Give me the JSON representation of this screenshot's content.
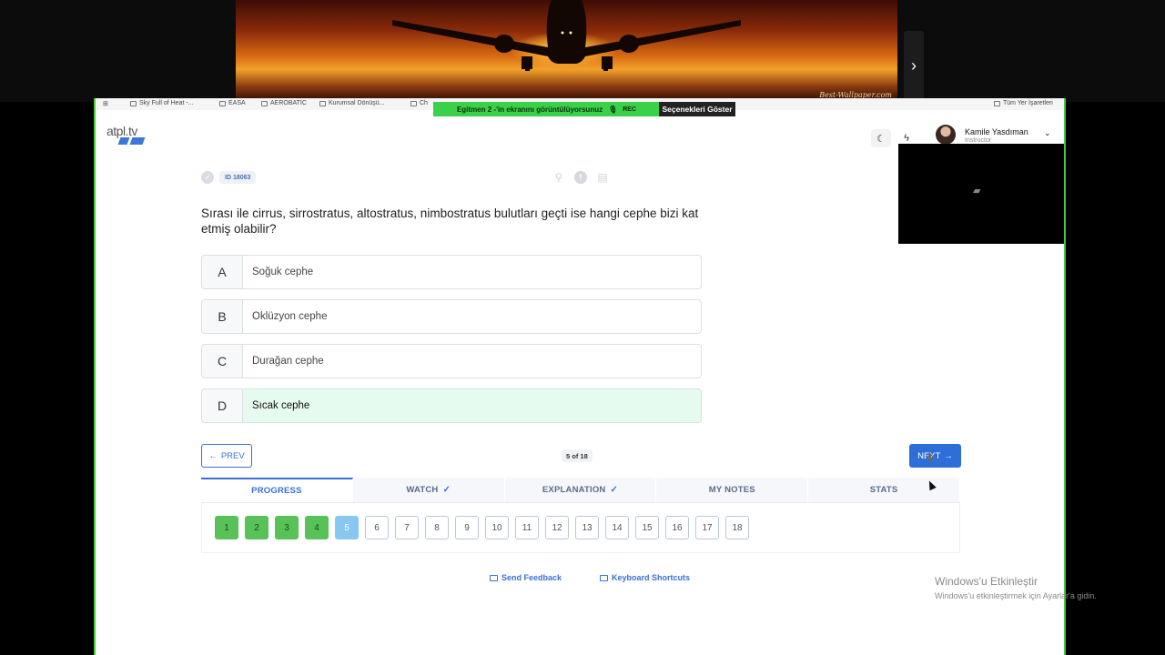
{
  "share": {
    "banner": "Egitmen 2 -'in ekranını görüntülüyorsunuz",
    "rec": "REC",
    "options_button": "Seçenekleri Göster",
    "watermark": "Best-Wallpaper.com"
  },
  "bookmarks": [
    "Sky Full of Heat -...",
    "EASA",
    "AEROBATIC",
    "Kurumsal Dönüşü...",
    "Ch",
    "Tüm Yer İşaretleri"
  ],
  "header": {
    "logo": "atpl.tv",
    "user_name": "Kamile Yasdıman",
    "user_role": "Instructor"
  },
  "question": {
    "id_label": "ID 18063",
    "text": "Sırası ile cirrus, sirrostratus, altostratus, nimbostratus bulutları geçti ise hangi cephe bizi kat etmiş olabilir?",
    "options": [
      {
        "letter": "A",
        "text": "Soğuk cephe",
        "correct": false
      },
      {
        "letter": "B",
        "text": "Oklüzyon cephe",
        "correct": false
      },
      {
        "letter": "C",
        "text": "Durağan cephe",
        "correct": false
      },
      {
        "letter": "D",
        "text": "Sıcak cephe",
        "correct": true
      }
    ]
  },
  "nav": {
    "prev_label": "PREV",
    "counter": "5 of 18",
    "next_label": "NEXT"
  },
  "tabs": [
    {
      "label": "PROGRESS",
      "active": true,
      "checked": false
    },
    {
      "label": "WATCH",
      "active": false,
      "checked": true
    },
    {
      "label": "EXPLANATION",
      "active": false,
      "checked": true
    },
    {
      "label": "MY NOTES",
      "active": false,
      "checked": false
    },
    {
      "label": "STATS",
      "active": false,
      "checked": false
    }
  ],
  "progress": {
    "numbers": [
      "1",
      "2",
      "3",
      "4",
      "5",
      "6",
      "7",
      "8",
      "9",
      "10",
      "11",
      "12",
      "13",
      "14",
      "15",
      "16",
      "17",
      "18"
    ],
    "done_count": 4,
    "current": 5
  },
  "footer": {
    "feedback": "Send Feedback",
    "shortcuts": "Keyboard Shortcuts"
  },
  "activation": {
    "title": "Windows'u Etkinleştir",
    "subtitle": "Windows'u etkinleştirmek için Ayarlar'a gidin."
  },
  "colors": {
    "accent": "#2e6ed8",
    "done": "#58c258",
    "current": "#89c7f0",
    "correct_bg": "#e6fbef",
    "share_green": "#3bd04a"
  }
}
